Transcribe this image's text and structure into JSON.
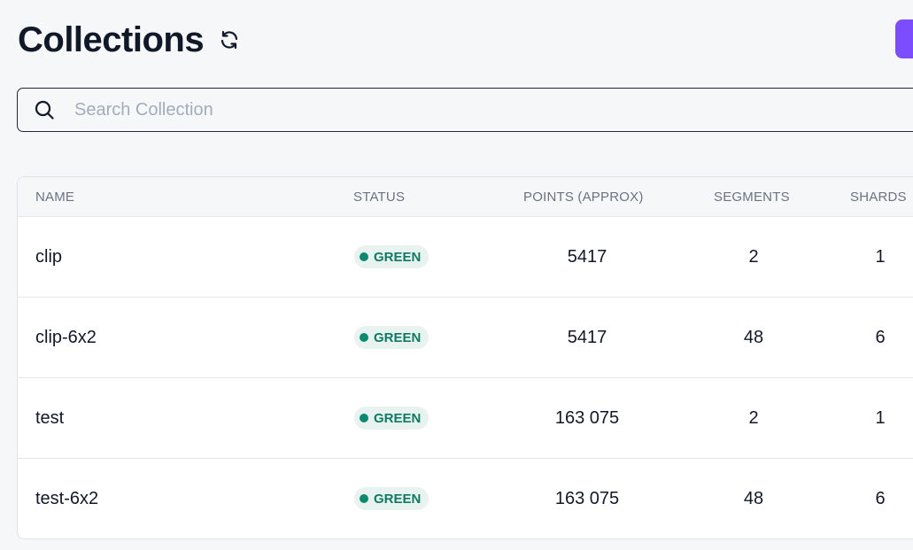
{
  "header": {
    "title": "Collections",
    "refresh_icon": "refresh-icon"
  },
  "search": {
    "placeholder": "Search Collection",
    "value": "",
    "icon": "search-icon"
  },
  "table": {
    "columns": {
      "name": "NAME",
      "status": "STATUS",
      "points": "POINTS (APPROX)",
      "segments": "SEGMENTS",
      "shards": "SHARDS"
    },
    "rows": [
      {
        "name": "clip",
        "status": "GREEN",
        "points": "5417",
        "segments": "2",
        "shards": "1"
      },
      {
        "name": "clip-6x2",
        "status": "GREEN",
        "points": "5417",
        "segments": "48",
        "shards": "6"
      },
      {
        "name": "test",
        "status": "GREEN",
        "points": "163 075",
        "segments": "2",
        "shards": "1"
      },
      {
        "name": "test-6x2",
        "status": "GREEN",
        "points": "163 075",
        "segments": "48",
        "shards": "6"
      }
    ]
  },
  "colors": {
    "accent": "#7c4dff",
    "status_green_text": "#0d7a63",
    "status_green_bg": "#e8f3f0"
  }
}
